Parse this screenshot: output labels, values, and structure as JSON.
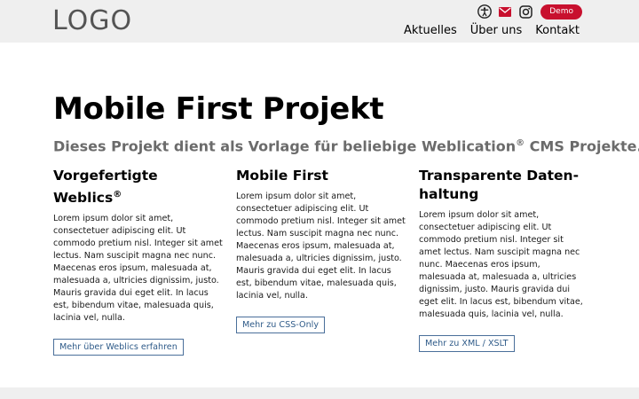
{
  "header": {
    "logo": "LOGO",
    "demo_label": "Demo",
    "icons": [
      "accessibility-icon",
      "mail-icon",
      "instagram-icon"
    ],
    "nav": [
      {
        "label": "Aktuelles"
      },
      {
        "label": "Über uns"
      },
      {
        "label": "Kontakt"
      }
    ],
    "accent_color": "#c8102e"
  },
  "main": {
    "title": "Mobile First Projekt",
    "subtitle_prefix": "Dieses Projekt dient als Vorlage für beliebige Weblication",
    "subtitle_sup": "®",
    "subtitle_suffix": " CMS Projekte.",
    "columns": [
      {
        "heading": "Vorgefertigte Weblics",
        "heading_sup": "®",
        "text": "Lorem ipsum dolor sit amet, consectetuer adipiscing elit. Ut commodo pretium nisl. Integer sit amet lectus. Nam suscipit magna nec nunc. Maecenas eros ipsum, malesuada at, malesuada a, ultricies dignissim, justo. Mauris gravida dui eget elit. In lacus est, bibendum vitae, malesuada quis, lacinia vel, nulla.",
        "button": "Mehr über Weblics erfahren"
      },
      {
        "heading": "Mobile First",
        "heading_sup": "",
        "text": "Lorem ipsum dolor sit amet, consectetuer adipiscing elit. Ut commodo pretium nisl. Integer sit amet lectus. Nam suscipit magna nec nunc. Maecenas eros ipsum, malesuada at, malesuada a, ultricies dignissim, justo. Mauris gravida dui eget elit. In lacus est, bibendum vitae, malesuada quis, lacinia vel, nulla.",
        "button": "Mehr zu CSS-Only"
      },
      {
        "heading": "Transparente Daten-haltung",
        "heading_sup": "",
        "text": "Lorem ipsum dolor sit amet, consectetuer adipiscing elit. Ut commodo pretium nisl. Integer sit amet lectus. Nam suscipit magna nec nunc. Maecenas eros ipsum, malesuada at, malesuada a, ultricies dignissim, justo. Mauris gravida dui eget elit. In lacus est, bibendum vitae, malesuada quis, lacinia vel, nulla.",
        "button": "Mehr zu XML / XSLT"
      }
    ]
  }
}
